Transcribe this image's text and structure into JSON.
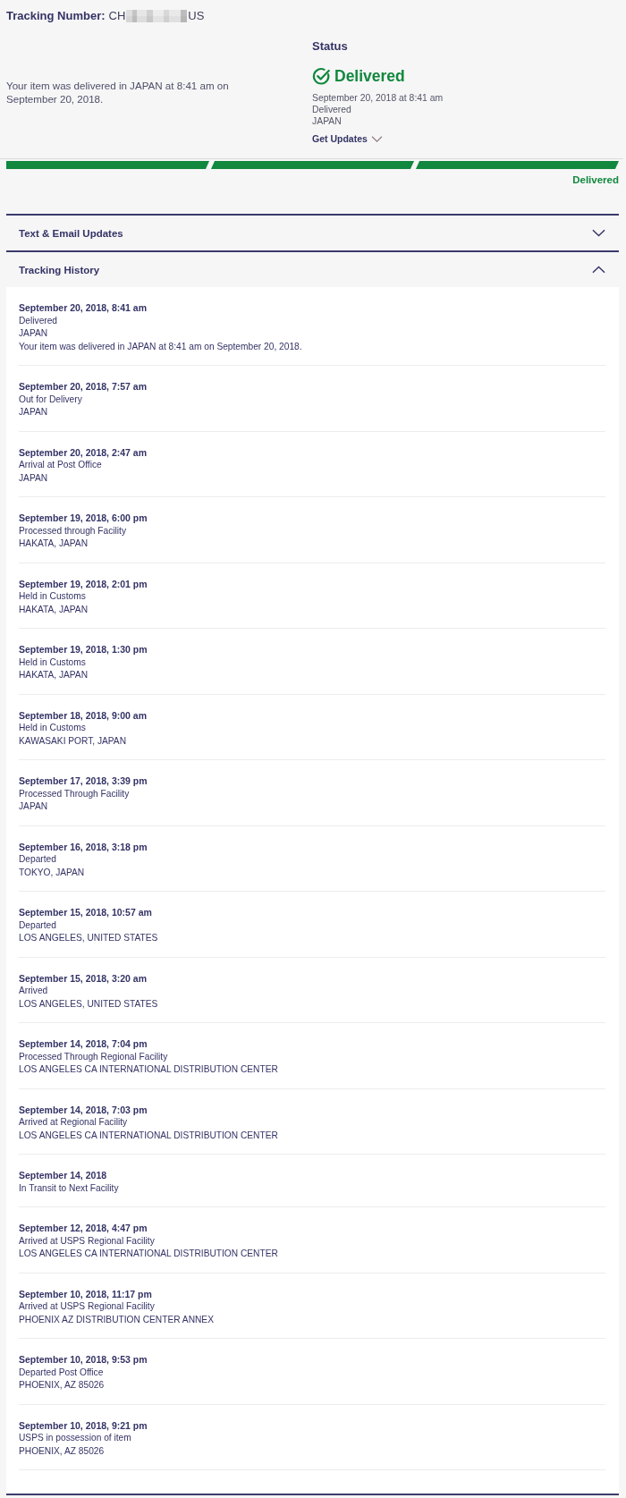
{
  "tracking": {
    "label": "Tracking Number:",
    "prefix": "CH",
    "redacted": true,
    "suffix": "US"
  },
  "summary": "Your item was delivered in JAPAN at 8:41 am on September 20, 2018.",
  "status": {
    "heading": "Status",
    "state": "Delivered",
    "date": "September 20, 2018 at 8:41 am",
    "event": "Delivered",
    "location": "JAPAN",
    "updates_link": "Get Updates",
    "updates_expanded": false
  },
  "progress": {
    "steps": [
      {
        "complete": true
      },
      {
        "complete": true
      },
      {
        "complete": true
      }
    ],
    "label": "Delivered"
  },
  "sections": [
    {
      "title": "Text & Email Updates",
      "expanded": false
    },
    {
      "title": "Tracking History",
      "expanded": true,
      "events": [
        {
          "date": "September 20, 2018, 8:41 am",
          "event": "Delivered",
          "location": "JAPAN",
          "note": "Your item was delivered in JAPAN at 8:41 am on September 20, 2018."
        },
        {
          "date": "September 20, 2018, 7:57 am",
          "event": "Out for Delivery",
          "location": "JAPAN"
        },
        {
          "date": "September 20, 2018, 2:47 am",
          "event": "Arrival at Post Office",
          "location": "JAPAN"
        },
        {
          "date": "September 19, 2018, 6:00 pm",
          "event": "Processed through Facility",
          "location": "HAKATA, JAPAN"
        },
        {
          "date": "September 19, 2018, 2:01 pm",
          "event": "Held in Customs",
          "location": "HAKATA, JAPAN"
        },
        {
          "date": "September 19, 2018, 1:30 pm",
          "event": "Held in Customs",
          "location": "HAKATA, JAPAN"
        },
        {
          "date": "September 18, 2018, 9:00 am",
          "event": "Held in Customs",
          "location": "KAWASAKI PORT, JAPAN"
        },
        {
          "date": "September 17, 2018, 3:39 pm",
          "event": "Processed Through Facility",
          "location": "JAPAN"
        },
        {
          "date": "September 16, 2018, 3:18 pm",
          "event": "Departed",
          "location": "TOKYO, JAPAN"
        },
        {
          "date": "September 15, 2018, 10:57 am",
          "event": "Departed",
          "location": "LOS ANGELES, UNITED STATES"
        },
        {
          "date": "September 15, 2018, 3:20 am",
          "event": "Arrived",
          "location": "LOS ANGELES, UNITED STATES"
        },
        {
          "date": "September 14, 2018, 7:04 pm",
          "event": "Processed Through Regional Facility",
          "location": "LOS ANGELES CA INTERNATIONAL DISTRIBUTION CENTER"
        },
        {
          "date": "September 14, 2018, 7:03 pm",
          "event": "Arrived at Regional Facility",
          "location": "LOS ANGELES CA INTERNATIONAL DISTRIBUTION CENTER"
        },
        {
          "date": "September 14, 2018",
          "event": "In Transit to Next Facility"
        },
        {
          "date": "September 12, 2018, 4:47 pm",
          "event": "Arrived at USPS Regional Facility",
          "location": "LOS ANGELES CA INTERNATIONAL DISTRIBUTION CENTER"
        },
        {
          "date": "September 10, 2018, 11:17 pm",
          "event": "Arrived at USPS Regional Facility",
          "location": "PHOENIX AZ DISTRIBUTION CENTER ANNEX"
        },
        {
          "date": "September 10, 2018, 9:53 pm",
          "event": "Departed Post Office",
          "location": "PHOENIX, AZ 85026"
        },
        {
          "date": "September 10, 2018, 9:21 pm",
          "event": "USPS in possession of item",
          "location": "PHOENIX, AZ 85026"
        }
      ]
    }
  ]
}
